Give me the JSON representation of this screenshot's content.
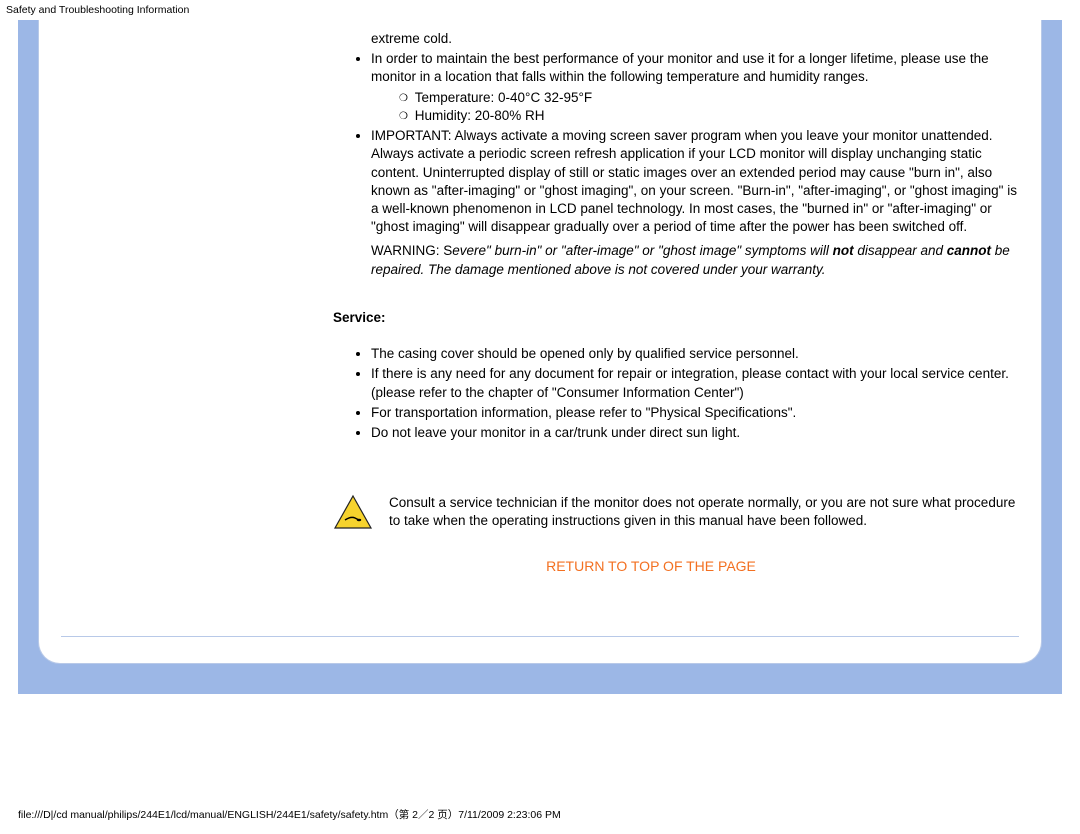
{
  "header_title": "Safety and Troubleshooting Information",
  "content": {
    "intro_line": "extreme cold.",
    "bullet_maintain": "In order to maintain the best performance of your monitor and use it for a longer lifetime, please use the monitor in a location that falls within the following temperature and humidity ranges.",
    "sub_temp": "Temperature: 0-40°C 32-95°F",
    "sub_humidity": "Humidity: 20-80% RH",
    "bullet_important": "IMPORTANT: Always activate a moving screen saver program when you leave your monitor unattended. Always activate a periodic screen refresh application if your LCD monitor will display unchanging static content. Uninterrupted display of still or static images over an extended period may cause \"burn in\", also known as \"after-imaging\" or \"ghost imaging\", on your screen. \"Burn-in\", \"after-imaging\", or \"ghost imaging\" is a well-known phenomenon in LCD panel technology. In most cases, the \"burned in\" or \"after-imaging\" or \"ghost imaging\" will disappear gradually over a period of time after the power has been switched off.",
    "warn_1": "WARNING: S",
    "warn_2": "evere\" burn-in\" or \"after-image\" or \"ghost image\" symptoms will ",
    "warn_not": "not",
    "warn_3": " disappear and ",
    "warn_cannot": "cannot",
    "warn_4": " be repaired. The damage mentioned above is not covered under your warranty."
  },
  "service": {
    "heading": "Service:",
    "item1": "The casing cover should be opened only by qualified service personnel.",
    "item2": "If there is any need for any document for repair or integration, please contact with your local service center. (please refer to the chapter of \"Consumer Information Center\")",
    "item3": "For transportation information, please refer to \"Physical Specifications\".",
    "item4": "Do not leave your monitor in a car/trunk under direct sun light.",
    "consult": "Consult a service technician if the monitor does not operate normally, or you are not sure what procedure to take when the operating instructions given in this manual have been followed."
  },
  "return_link": "RETURN TO TOP OF THE PAGE",
  "footer": "file:///D|/cd manual/philips/244E1/lcd/manual/ENGLISH/244E1/safety/safety.htm（第 2／2 页）7/11/2009 2:23:06 PM"
}
